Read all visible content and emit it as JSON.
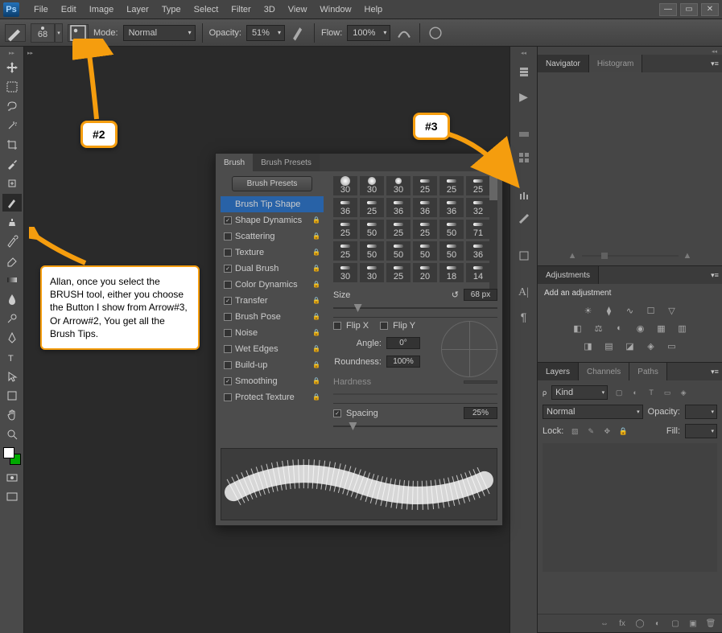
{
  "menu": {
    "items": [
      "File",
      "Edit",
      "Image",
      "Layer",
      "Type",
      "Select",
      "Filter",
      "3D",
      "View",
      "Window",
      "Help"
    ]
  },
  "options_bar": {
    "brush_size": "68",
    "mode_label": "Mode:",
    "mode_value": "Normal",
    "opacity_label": "Opacity:",
    "opacity_value": "51%",
    "flow_label": "Flow:",
    "flow_value": "100%"
  },
  "right_tabs": {
    "navigator": "Navigator",
    "histogram": "Histogram",
    "adjustments": "Adjustments",
    "add_adjustment": "Add an adjustment",
    "layers": "Layers",
    "channels": "Channels",
    "paths": "Paths",
    "kind": "Kind",
    "blend": "Normal",
    "opacity_label": "Opacity:",
    "lock_label": "Lock:",
    "fill_label": "Fill:"
  },
  "brush_panel": {
    "tab_brush": "Brush",
    "tab_presets": "Brush Presets",
    "presets_btn": "Brush Presets",
    "options": [
      {
        "label": "Brush Tip Shape",
        "cb": null,
        "selected": true,
        "lock": false
      },
      {
        "label": "Shape Dynamics",
        "cb": true,
        "lock": true
      },
      {
        "label": "Scattering",
        "cb": false,
        "lock": true
      },
      {
        "label": "Texture",
        "cb": false,
        "lock": true
      },
      {
        "label": "Dual Brush",
        "cb": true,
        "lock": true
      },
      {
        "label": "Color Dynamics",
        "cb": false,
        "lock": true
      },
      {
        "label": "Transfer",
        "cb": true,
        "lock": true
      },
      {
        "label": "Brush Pose",
        "cb": false,
        "lock": true
      },
      {
        "label": "Noise",
        "cb": false,
        "lock": true
      },
      {
        "label": "Wet Edges",
        "cb": false,
        "lock": true
      },
      {
        "label": "Build-up",
        "cb": false,
        "lock": true
      },
      {
        "label": "Smoothing",
        "cb": true,
        "lock": true
      },
      {
        "label": "Protect Texture",
        "cb": false,
        "lock": true
      }
    ],
    "tips_row_labels": [
      [
        "30",
        "30",
        "30",
        "25",
        "25",
        "25"
      ],
      [
        "36",
        "25",
        "36",
        "36",
        "36",
        "32"
      ],
      [
        "25",
        "50",
        "25",
        "25",
        "50",
        "71"
      ],
      [
        "25",
        "50",
        "50",
        "50",
        "50",
        "36"
      ],
      [
        "30",
        "30",
        "25",
        "20",
        "18",
        "14"
      ]
    ],
    "size_label": "Size",
    "size_value": "68 px",
    "flipx_label": "Flip X",
    "flipy_label": "Flip Y",
    "angle_label": "Angle:",
    "angle_value": "0°",
    "roundness_label": "Roundness:",
    "roundness_value": "100%",
    "hardness_label": "Hardness",
    "spacing_label": "Spacing",
    "spacing_value": "25%"
  },
  "annotations": {
    "badge2": "#2",
    "badge3": "#3",
    "callout": "Allan, once you select the BRUSH tool, either you choose the Button I show from Arrow#3, Or Arrow#2, You get all the Brush Tips."
  }
}
